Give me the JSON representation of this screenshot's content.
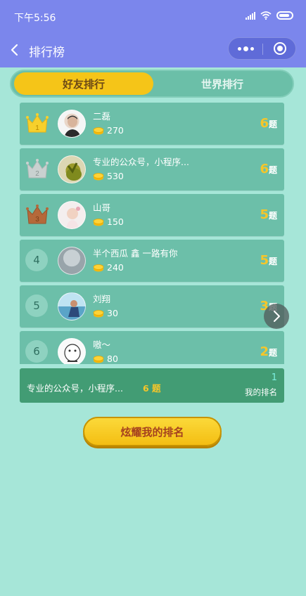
{
  "status_bar": {
    "time": "下午5:56"
  },
  "nav": {
    "title": "排行榜"
  },
  "tabs": {
    "friends": "好友排行",
    "world": "世界排行",
    "active": "friends"
  },
  "rows": [
    {
      "rank": "1",
      "rank_style": "gold-crown",
      "name": "二磊",
      "coins": "270",
      "score": "6",
      "unit": "题"
    },
    {
      "rank": "2",
      "rank_style": "silver-crown",
      "name": "专业的公众号，小程序...",
      "coins": "530",
      "score": "6",
      "unit": "题"
    },
    {
      "rank": "3",
      "rank_style": "bronze-crown",
      "name": "山哥",
      "coins": "150",
      "score": "5",
      "unit": "题"
    },
    {
      "rank": "4",
      "rank_style": "circle",
      "name": "半个西瓜 鑫 一路有你",
      "coins": "240",
      "score": "5",
      "unit": "题"
    },
    {
      "rank": "5",
      "rank_style": "circle",
      "name": "刘翔",
      "coins": "30",
      "score": "3",
      "unit": "题"
    },
    {
      "rank": "6",
      "rank_style": "circle",
      "name": "嗷～",
      "coins": "80",
      "score": "2",
      "unit": "题"
    }
  ],
  "my_rank": {
    "name": "专业的公众号，小程序...",
    "score": "6 题",
    "rank": "1",
    "label": "我的排名"
  },
  "share_button": {
    "label": "炫耀我的排名"
  },
  "colors": {
    "nav": "#7b86ec",
    "background": "#a6e6d8",
    "accent": "#f5c518"
  },
  "icons": {
    "back": "chevron-left-icon",
    "more": "more-dots-icon",
    "close": "target-icon",
    "coin": "coin-stack-icon",
    "crown": "crown-icon",
    "scroll": "chevron-right-icon"
  }
}
